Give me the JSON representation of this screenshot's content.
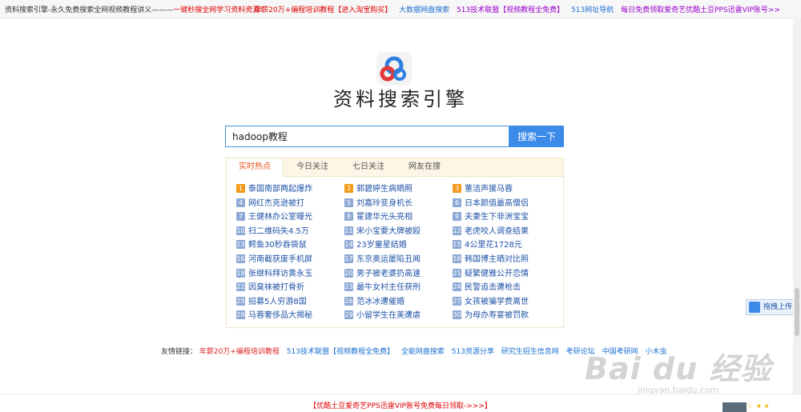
{
  "topbar": {
    "left_prefix": "资料搜索引擎-永久免费搜索全网视频教程讲义———",
    "left_highlight": "一键秒搜全网学习资料资源!",
    "links": [
      {
        "text": "年薪20万+编程培训教程【进入淘宝购买】",
        "color": "#e00000"
      },
      {
        "text": "大数据网盘搜索",
        "color": "#1a6fd0"
      },
      {
        "text": "513技术联盟【视频教程全免费】",
        "color": "#9900cc"
      },
      {
        "text": "513网址导航",
        "color": "#1a6fd0"
      },
      {
        "text": "每日免费领取爱奇艺优酷土豆PPS迅雷VIP账号>>",
        "color": "#9900cc"
      }
    ]
  },
  "logo": {
    "text": "资料搜索引擎"
  },
  "search": {
    "value": "hadoop教程",
    "button": "搜索一下"
  },
  "tabs": [
    "实时热点",
    "今日关注",
    "七日关注",
    "网友在搜"
  ],
  "hot_items": [
    "泰国南部两起爆炸",
    "郭碧婷生病晒照",
    "董洁声援马蓉",
    "网红杰克逊被打",
    "刘嘉玲变身机长",
    "日本颜值最高僧侣",
    "王健林办公室曝光",
    "霍建华光头亮相",
    "夫妻生下非洲宝宝",
    "扫二维码失4.5万",
    "宋小宝要大牌被殴",
    "老虎咬人调查结果",
    "鳄鱼30秒吞袋鼠",
    "23岁童星结婚",
    "4公里花1728元",
    "河南截获废手机屏",
    "东京奥运屡陷丑闻",
    "韩国博主晒对比照",
    "张继科拜访黄永玉",
    "男子被老婆扔高速",
    "疑繁健雅公开恋情",
    "因臭袜被打骨折",
    "最牛女村主任获刑",
    "民警追击遭枪击",
    "招募5人穷游8国",
    "范冰冰遭催婚",
    "女孩被骗学费离世",
    "马蓉奢侈品大揭秘",
    "小留学生在美遭虐",
    "为母办寿宴被罚款"
  ],
  "friend": {
    "label": "友情链接：",
    "links": [
      "年薪20万+编程培训教程",
      "513技术联盟【视频教程全免费】",
      "全能网盘搜索",
      "513资源分享",
      "研究生招生信息网",
      "考研论坛",
      "中国考研网",
      "小木虫"
    ]
  },
  "bottom": {
    "text": "【优酷土豆爱奇艺PPS迅雷VIP账号免费每日领取->>>】"
  },
  "upload": {
    "text": "拖拽上传"
  },
  "watermark": {
    "line1": "Bai du 经验",
    "line2": "jingyan.baidu.com"
  },
  "colors": {
    "accent": "#3d8be8",
    "hot_top": "#f29a1a",
    "hot_rest": "#8ea9d6",
    "link": "#1f52a6"
  }
}
